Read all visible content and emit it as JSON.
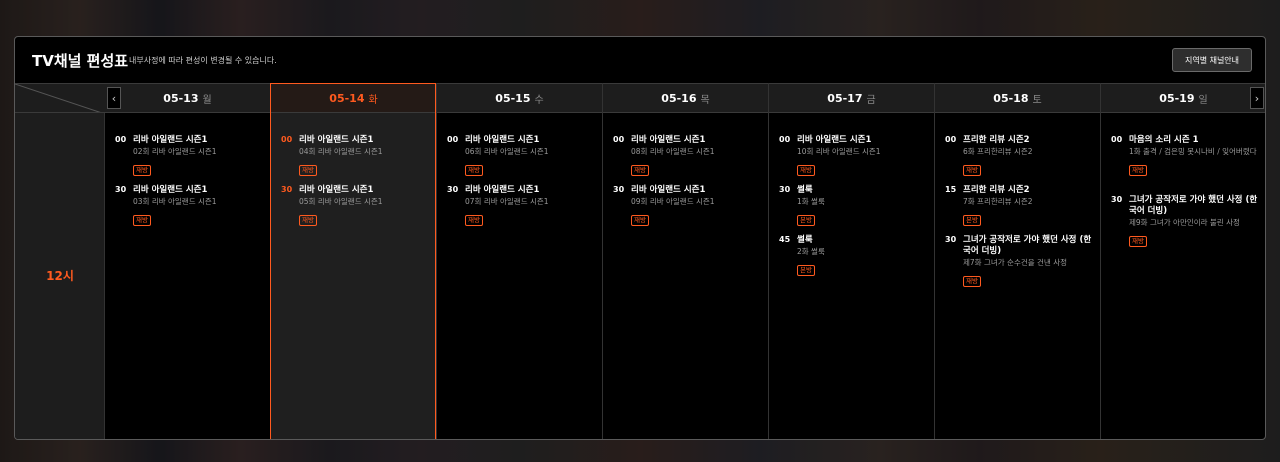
{
  "header": {
    "title": "TV채널 편성표",
    "subtitle": "내부사정에 따라 편성이 변경될 수 있습니다.",
    "region_button": "지역별 채널안내"
  },
  "hour_label": "12시",
  "nav": {
    "prev": "‹",
    "next": "›"
  },
  "days": [
    {
      "date": "05-13",
      "dow": "월",
      "programs": [
        {
          "min": "00",
          "name": "리바 아일랜드 시즌1",
          "ep": "02회 리바 아일랜드 시즌1",
          "badge": "재방"
        },
        {
          "min": "30",
          "name": "리바 아일랜드 시즌1",
          "ep": "03회 리바 아일랜드 시즌1",
          "badge": "재방"
        }
      ]
    },
    {
      "date": "05-14",
      "dow": "화",
      "programs": [
        {
          "min": "00",
          "name": "리바 아일랜드 시즌1",
          "ep": "04회 리바 아일랜드 시즌1",
          "badge": "재방"
        },
        {
          "min": "30",
          "name": "리바 아일랜드 시즌1",
          "ep": "05회 리바 아일랜드 시즌1",
          "badge": "재방"
        }
      ]
    },
    {
      "date": "05-15",
      "dow": "수",
      "programs": [
        {
          "min": "00",
          "name": "리바 아일랜드 시즌1",
          "ep": "06회 리바 아일랜드 시즌1",
          "badge": "재방"
        },
        {
          "min": "30",
          "name": "리바 아일랜드 시즌1",
          "ep": "07회 리바 아일랜드 시즌1",
          "badge": "재방"
        }
      ]
    },
    {
      "date": "05-16",
      "dow": "목",
      "programs": [
        {
          "min": "00",
          "name": "리바 아일랜드 시즌1",
          "ep": "08회 리바 아일랜드 시즌1",
          "badge": "재방"
        },
        {
          "min": "30",
          "name": "리바 아일랜드 시즌1",
          "ep": "09회 리바 아일랜드 시즌1",
          "badge": "재방"
        }
      ]
    },
    {
      "date": "05-17",
      "dow": "금",
      "programs": [
        {
          "min": "00",
          "name": "리바 아일랜드 시즌1",
          "ep": "10회 리바 아일랜드 시즌1",
          "badge": "재방"
        },
        {
          "min": "30",
          "name": "썰룩",
          "ep": "1화 썰룩",
          "badge": "본방"
        },
        {
          "min": "45",
          "name": "썰룩",
          "ep": "2화 썰룩",
          "badge": "본방"
        }
      ]
    },
    {
      "date": "05-18",
      "dow": "토",
      "programs": [
        {
          "min": "00",
          "name": "프리한 리뷰 시즌2",
          "ep": "6화 프리한리뷰 시즌2",
          "badge": "재방"
        },
        {
          "min": "15",
          "name": "프리한 리뷰 시즌2",
          "ep": "7화 프리한리뷰 시즌2",
          "badge": "본방"
        },
        {
          "min": "30",
          "name": "그녀가 공작저로 가야 했던 사정 (한국어 더빙)",
          "ep": "제7화 그녀가 순수건을 건낸 사정",
          "badge": "재방"
        }
      ]
    },
    {
      "date": "05-19",
      "dow": "일",
      "programs": [
        {
          "min": "00",
          "name": "마음의 소리 시즌 1",
          "ep": "1화 출격 / 검은밍 못시나비 / 잊어버렸다",
          "badge": "재방"
        },
        {
          "min": "30",
          "name": "그녀가 공작저로 가야 했던 사정 (한국어 더빙)",
          "ep": "제9화 그녀가 아만인이라 불린 사정",
          "badge": "재방"
        }
      ]
    }
  ]
}
